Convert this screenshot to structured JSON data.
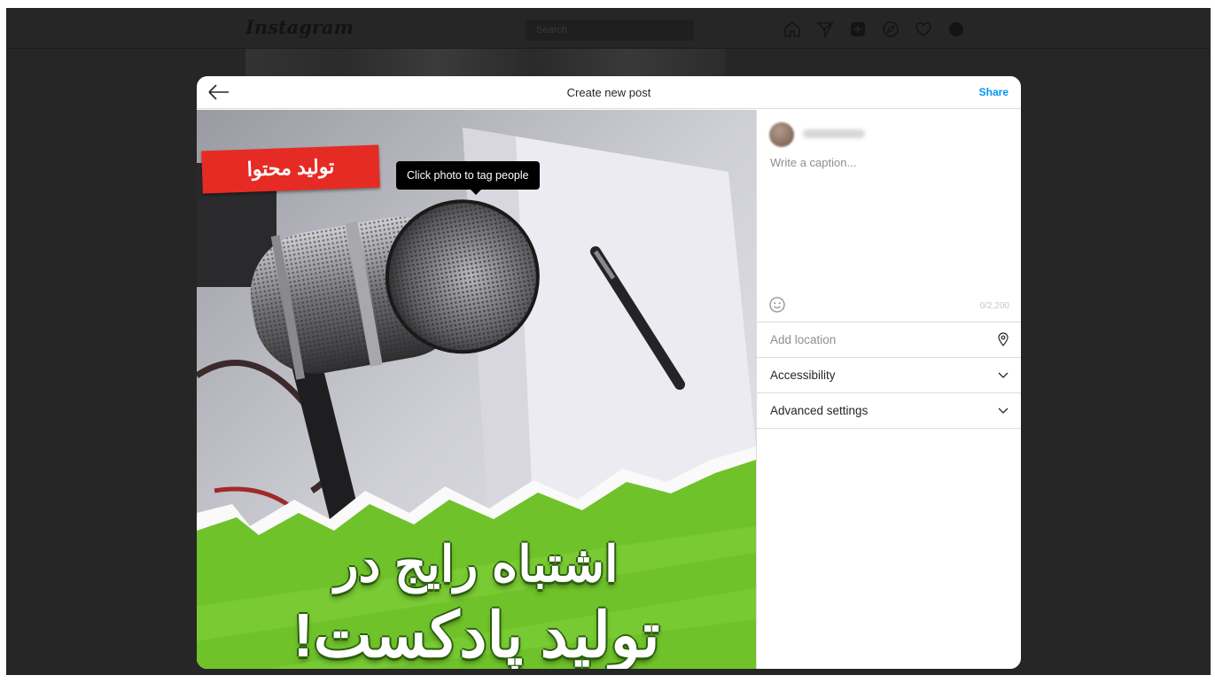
{
  "app": {
    "logo_text": "Instagram",
    "search_placeholder": "Search"
  },
  "nav_icons": [
    "home-icon",
    "direct-icon",
    "new-post-icon",
    "explore-icon",
    "activity-heart-icon",
    "profile-avatar-icon"
  ],
  "modal": {
    "title": "Create new post",
    "share_label": "Share",
    "tooltip": "Click photo to tag people",
    "caption_placeholder": "Write a caption...",
    "char_count": "0/2,200",
    "location_placeholder": "Add location",
    "accessibility_label": "Accessibility",
    "advanced_label": "Advanced settings"
  },
  "photo": {
    "red_label": "تولید محتوا",
    "headline_line1": "اشتباه رایج در",
    "headline_line2": "تولید پادکست!"
  },
  "colors": {
    "accent": "#0095f6",
    "backdrop": "#262626",
    "label_red": "#e62b24",
    "banner_green": "#6fc22a"
  }
}
